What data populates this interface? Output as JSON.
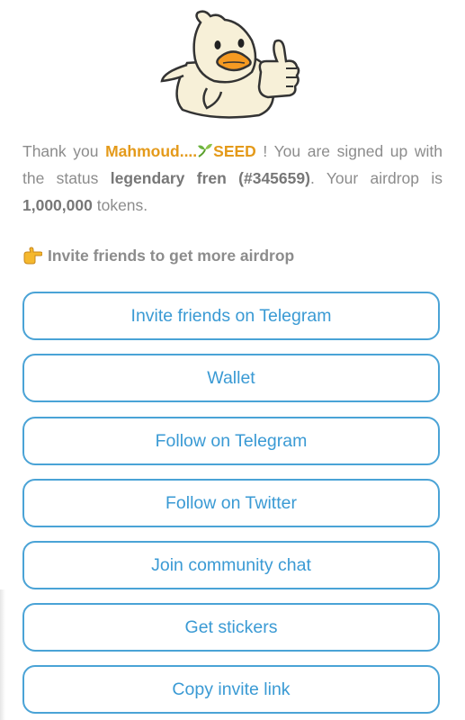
{
  "message": {
    "thank_you": "Thank you",
    "username": "Mahmoud....",
    "seed": "SEED",
    "signed_up_text": "! You are signed up with the status",
    "status": "legendary fren (#345659)",
    "airdrop_prefix": ". Your airdrop is",
    "amount": "1,000,000",
    "airdrop_suffix": "tokens."
  },
  "invite_header": "Invite friends to get more airdrop",
  "buttons": [
    {
      "label": "Invite friends on Telegram"
    },
    {
      "label": "Wallet"
    },
    {
      "label": "Follow on Telegram"
    },
    {
      "label": "Follow on Twitter"
    },
    {
      "label": "Join community chat"
    },
    {
      "label": "Get stickers"
    },
    {
      "label": "Copy invite link"
    }
  ],
  "colors": {
    "accent": "#4aa3d6",
    "highlight": "#e49a1a",
    "text": "#8c8c8c"
  },
  "icons": [
    "duck-mascot",
    "sprout-icon",
    "pointing-hand-icon"
  ]
}
